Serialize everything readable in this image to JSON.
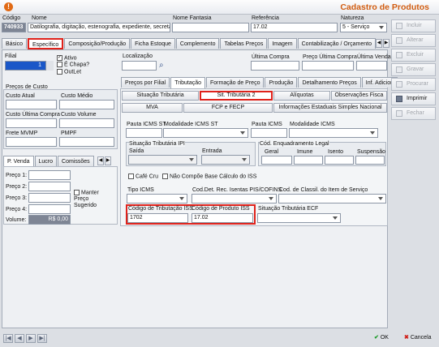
{
  "title": "Cadastro de Produtos",
  "header": {
    "codigo_label": "Código",
    "codigo_value": "740933",
    "nome_label": "Nome",
    "nome_value": "Datilografia, digitação, estenografia, expediente, secreta",
    "fantasia_label": "Nome Fantasia",
    "fantasia_value": "",
    "referencia_label": "Referência",
    "referencia_value": "17.02",
    "natureza_label": "Natureza",
    "natureza_value": "5 - Serviço"
  },
  "tabs": [
    "Básico",
    "Específico",
    "Composição/Produção",
    "Ficha Estoque",
    "Complemento",
    "Tabelas Preços",
    "Imagem",
    "Contabilização / Orçamento"
  ],
  "left": {
    "filial_label": "Filial",
    "filial_value": "1",
    "ativo": "Ativo",
    "chapa": "É Chapa?",
    "outlet": "OutLet",
    "precos_custo": "Preços de Custo",
    "custo_atual": "Custo Atual",
    "custo_medio": "Custo Médio",
    "custo_ultima": "Custo Última Compra",
    "custo_volume": "Custo Volume",
    "frete": "Frete MVMP",
    "pmpf": "PMPF",
    "sub_tabs": [
      "P. Venda",
      "Lucro",
      "Comissões"
    ],
    "precos": [
      "Preço 1:",
      "Preço 2:",
      "Preço 3:",
      "Preço 4:"
    ],
    "manter": "Manter Preço Sugerido",
    "volume_label": "Volume:",
    "volume_value": "R$ 0,00"
  },
  "right": {
    "localizacao": "Localização",
    "ultima_compra": "Última Compra",
    "preco_ultima": "Preço Última Compra",
    "ultima_venda": "Última Venda",
    "tabs1": [
      "Preços por Filial",
      "Tributação",
      "Formação de Preço",
      "Produção",
      "Detalhamento Preços",
      "Inf. Adicion"
    ],
    "tabs2": [
      "Situação Tributária",
      "Sit. Tributária 2",
      "Alíquotas",
      "Observações Fisca"
    ],
    "tabs3": [
      "MVA",
      "FCP e FECP",
      "Informações Estaduais Simples Nacional"
    ],
    "pauta_st": "Pauta ICMS ST",
    "modalidade_st": "Modalidade ICMS ST",
    "pauta_icms": "Pauta ICMS",
    "modalidade_icms": "Modalidade ICMS",
    "ipi_title": "Situação Tributária IPI",
    "saida": "Saída",
    "entrada": "Entrada",
    "enq_title": "Cód. Enquadramento Legal",
    "geral": "Geral",
    "imune": "Imune",
    "isento": "Isento",
    "suspensao": "Suspensão",
    "cafe_cru": "Café Cru",
    "nao_compoe": "Não Compõe Base Cálculo do ISS",
    "tipo_icms": "Tipo ICMS",
    "cod_det": "Cod.Det. Rec. Isentas PIS/COFINS",
    "cod_classil": "Cod. de Classil. do Item de Serviço",
    "cod_trib_iss_label": "Código de Tributação ISS",
    "cod_trib_iss_value": "1702",
    "cod_prod_iss_label": "Código de Produto ISS",
    "cod_prod_iss_value": "17.02",
    "sit_trib_ecf": "Situação Tributária ECF"
  },
  "side": [
    "Incluir",
    "Alterar",
    "Excluir",
    "Gravar",
    "Procurar",
    "Imprimir",
    "Fechar"
  ],
  "bottom": {
    "ok": "OK",
    "cancel": "Cancela"
  }
}
